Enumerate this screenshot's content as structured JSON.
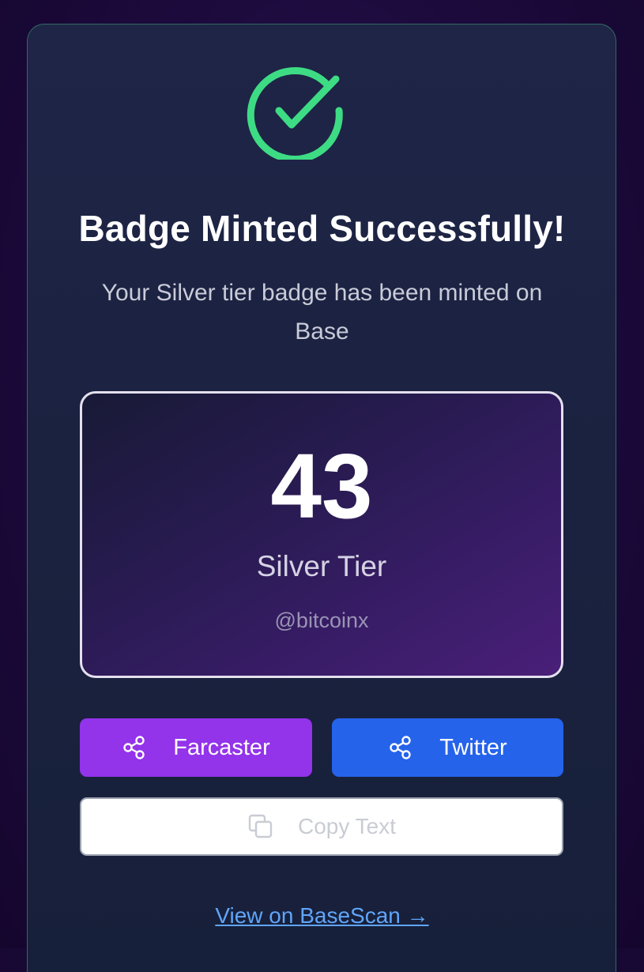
{
  "success": {
    "icon": "check-circle-icon",
    "title": "Badge Minted Successfully!",
    "message": "Your Silver tier badge has been minted on Base"
  },
  "badge": {
    "score": "43",
    "tier": "Silver Tier",
    "handle": "@bitcoinx"
  },
  "actions": {
    "farcaster_label": "Farcaster",
    "twitter_label": "Twitter",
    "copy_label": "Copy Text",
    "view_link": "View on BaseScan →"
  },
  "colors": {
    "success_green": "#3ddc84",
    "farcaster_purple": "#9333ea",
    "twitter_blue": "#2563eb",
    "link_blue": "#60a5fa"
  }
}
